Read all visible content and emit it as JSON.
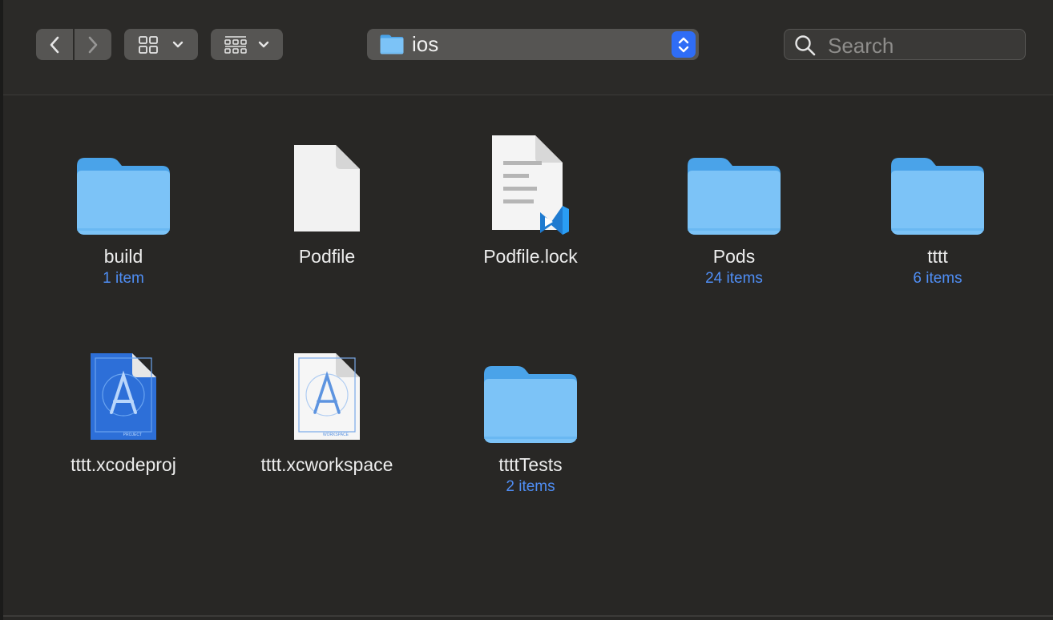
{
  "window": {
    "path_title": "ios",
    "search_placeholder": "Search"
  },
  "toolbar": {
    "back_icon": "chevron-left-icon",
    "forward_icon": "chevron-right-icon",
    "view_icon": "icon-grid-view-icon",
    "group_icon": "group-by-icon",
    "accent": "#2f6df6"
  },
  "files": [
    {
      "name": "build",
      "count": "1 item",
      "kind": "folder"
    },
    {
      "name": "Podfile",
      "count": "",
      "kind": "document"
    },
    {
      "name": "Podfile.lock",
      "count": "",
      "kind": "vscode-document"
    },
    {
      "name": "Pods",
      "count": "24 items",
      "kind": "folder"
    },
    {
      "name": "tttt",
      "count": "6 items",
      "kind": "folder"
    },
    {
      "name": "tttt.xcodeproj",
      "count": "",
      "kind": "xcode-project"
    },
    {
      "name": "tttt.xcworkspace",
      "count": "",
      "kind": "xcode-workspace"
    },
    {
      "name": "ttttTests",
      "count": "2 items",
      "kind": "folder"
    }
  ],
  "colors": {
    "background": "#282725",
    "folder": "#7cc3f7",
    "item_count": "#4f8ef5"
  }
}
